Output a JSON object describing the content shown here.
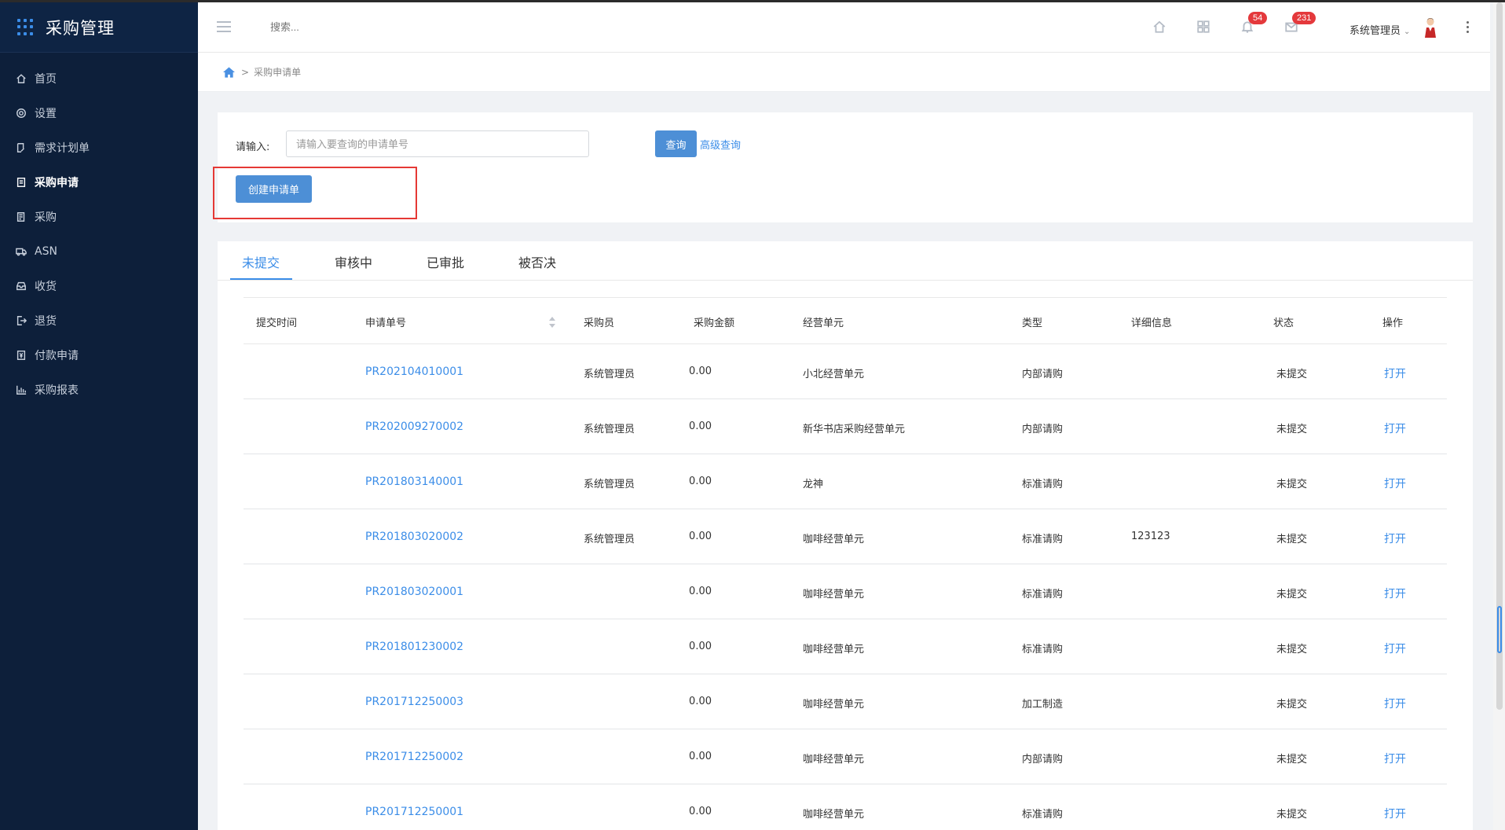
{
  "app": {
    "title": "采购管理"
  },
  "sidebar": {
    "items": [
      {
        "label": "首页",
        "icon": "home-icon"
      },
      {
        "label": "设置",
        "icon": "gear-icon"
      },
      {
        "label": "需求计划单",
        "icon": "edit-doc-icon"
      },
      {
        "label": "采购申请",
        "icon": "document-icon",
        "active": true
      },
      {
        "label": "采购",
        "icon": "list-doc-icon"
      },
      {
        "label": "ASN",
        "icon": "truck-icon"
      },
      {
        "label": "收货",
        "icon": "inbox-icon"
      },
      {
        "label": "退货",
        "icon": "return-icon"
      },
      {
        "label": "付款申请",
        "icon": "payment-doc-icon"
      },
      {
        "label": "采购报表",
        "icon": "bar-chart-icon"
      }
    ]
  },
  "header": {
    "search_placeholder": "搜索...",
    "notifications_count": "54",
    "messages_count": "231",
    "user_name": "系统管理员"
  },
  "breadcrumb": {
    "current": "采购申请单",
    "separator": ">"
  },
  "query": {
    "label": "请输入:",
    "placeholder": "请输入要查询的申请单号",
    "search_button": "查询",
    "advanced_link": "高级查询",
    "create_button": "创建申请单"
  },
  "tabs": [
    {
      "label": "未提交",
      "active": true
    },
    {
      "label": "审核中"
    },
    {
      "label": "已审批"
    },
    {
      "label": "被否决"
    }
  ],
  "table": {
    "columns": [
      "提交时间",
      "申请单号",
      "采购员",
      "采购金额",
      "经营单元",
      "类型",
      "详细信息",
      "状态",
      "操作"
    ],
    "rows": [
      {
        "submit_time": "",
        "number": "PR202104010001",
        "buyer": "系统管理员",
        "amount": "0.00",
        "unit": "小北经营单元",
        "type": "内部请购",
        "detail": "",
        "status": "未提交",
        "action": "打开"
      },
      {
        "submit_time": "",
        "number": "PR202009270002",
        "buyer": "系统管理员",
        "amount": "0.00",
        "unit": "新华书店采购经营单元",
        "type": "内部请购",
        "detail": "",
        "status": "未提交",
        "action": "打开"
      },
      {
        "submit_time": "",
        "number": "PR201803140001",
        "buyer": "系统管理员",
        "amount": "0.00",
        "unit": "龙神",
        "type": "标准请购",
        "detail": "",
        "status": "未提交",
        "action": "打开"
      },
      {
        "submit_time": "",
        "number": "PR201803020002",
        "buyer": "系统管理员",
        "amount": "0.00",
        "unit": "咖啡经营单元",
        "type": "标准请购",
        "detail": "123123",
        "status": "未提交",
        "action": "打开"
      },
      {
        "submit_time": "",
        "number": "PR201803020001",
        "buyer": "",
        "amount": "0.00",
        "unit": "咖啡经营单元",
        "type": "标准请购",
        "detail": "",
        "status": "未提交",
        "action": "打开"
      },
      {
        "submit_time": "",
        "number": "PR201801230002",
        "buyer": "",
        "amount": "0.00",
        "unit": "咖啡经营单元",
        "type": "标准请购",
        "detail": "",
        "status": "未提交",
        "action": "打开"
      },
      {
        "submit_time": "",
        "number": "PR201712250003",
        "buyer": "",
        "amount": "0.00",
        "unit": "咖啡经营单元",
        "type": "加工制造",
        "detail": "",
        "status": "未提交",
        "action": "打开"
      },
      {
        "submit_time": "",
        "number": "PR201712250002",
        "buyer": "",
        "amount": "0.00",
        "unit": "咖啡经营单元",
        "type": "内部请购",
        "detail": "",
        "status": "未提交",
        "action": "打开"
      },
      {
        "submit_time": "",
        "number": "PR201712250001",
        "buyer": "",
        "amount": "0.00",
        "unit": "咖啡经营单元",
        "type": "标准请购",
        "detail": "",
        "status": "未提交",
        "action": "打开"
      }
    ]
  },
  "colors": {
    "sidebar_bg": "#0d1f3a",
    "accent": "#3b8de8",
    "primary_button": "#4d8fd6",
    "badge": "#e4393c",
    "highlight_box": "#e53935"
  }
}
